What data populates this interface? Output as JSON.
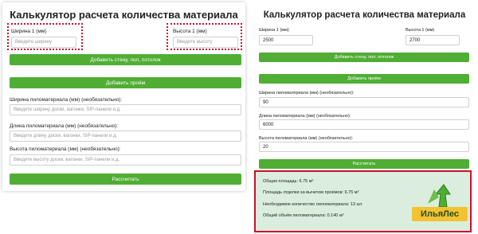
{
  "left": {
    "title": "Калькулятор расчета количества материала",
    "width_label": "Ширина 1 (мм)",
    "width_placeholder": "Введите ширину",
    "height_label": "Высота 1 (мм)",
    "height_placeholder": "Введите высоту",
    "add_wall_button": "Добавить стену, пол, потолок",
    "add_opening_button": "Добавить проём",
    "lumber_width_label": "Ширина пиломатериала (мм) (необязательно):",
    "lumber_width_placeholder": "Введите ширину доски, вагонки, SIP-панели и.д.",
    "lumber_length_label": "Длина пиломатериала (мм) (необязательно):",
    "lumber_length_placeholder": "Введите длину доски, вагонки, SIP-панели и.д.",
    "lumber_height_label": "Высота пиломатериала (мм) (необязательно):",
    "lumber_height_placeholder": "Введите высоту доски, вагонки, SIP-панели и.д.",
    "calculate_button": "Рассчитать"
  },
  "right": {
    "title": "Калькулятор расчета количества материала",
    "width_label": "Ширина 1 (мм)",
    "width_value": "2500",
    "height_label": "Высота 1 (мм)",
    "height_value": "2700",
    "add_wall_button": "Добавить стену, пол, потолок",
    "add_opening_button": "Добавить проём",
    "lumber_width_label": "Ширина пиломатериала (мм) (необязательно):",
    "lumber_width_value": "90",
    "lumber_length_label": "Длина пиломатериала (мм) (необязательно):",
    "lumber_length_value": "6000",
    "lumber_height_label": "Высота пиломатериала (мм) (необязательно):",
    "lumber_height_value": "20",
    "calculate_button": "Рассчитать",
    "results": {
      "total_area": "Общая площадь: 6.75 м²",
      "finish_area": "Площадь отделки за вычетом проёмов: 6.75 м²",
      "quantity": "Необходимое количество пиломатериала: 13 шт.",
      "volume": "Общий объём пиломатериала: 0.140 м³"
    },
    "logo_text": "ИльяЛес"
  },
  "colors": {
    "button_green": "#4fae33",
    "highlight_red": "#c8102e",
    "result_bg": "#dbeede",
    "logo_yellow": "#f2c230"
  }
}
